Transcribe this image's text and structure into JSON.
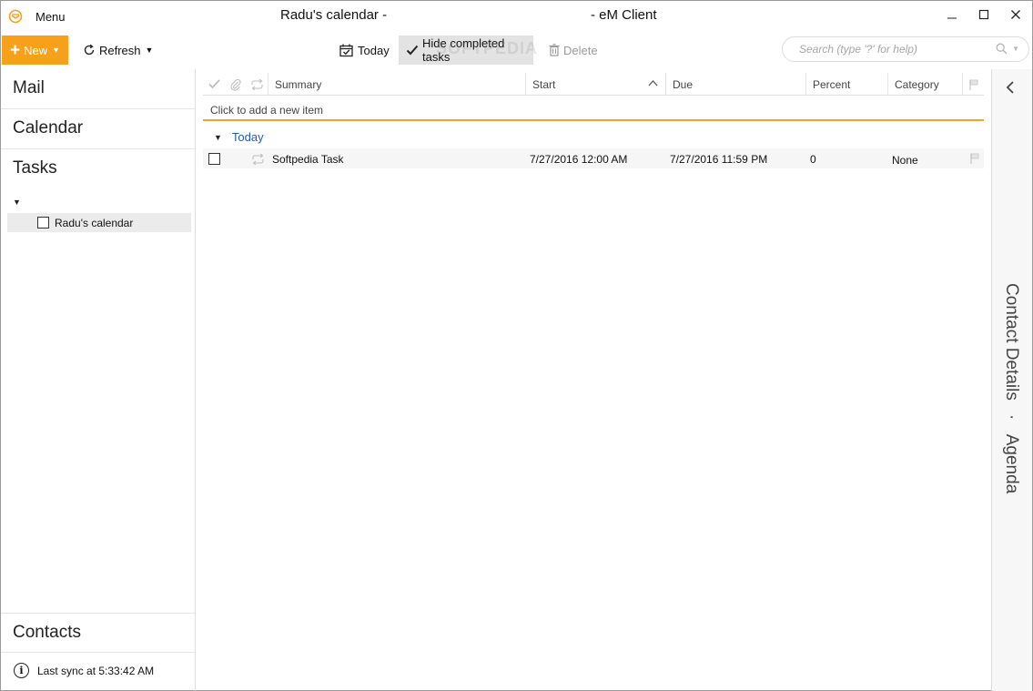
{
  "app": {
    "menu_label": "Menu",
    "title_left": "Radu's calendar -",
    "title_right": "- eM Client",
    "watermark": "SOFTPEDIA",
    "accent_color": "#f7a01b"
  },
  "window_controls": {
    "minimize_icon": "minimize-icon",
    "maximize_icon": "maximize-icon",
    "close_icon": "close-icon"
  },
  "toolbar": {
    "new_label": "New",
    "refresh_label": "Refresh",
    "today_label": "Today",
    "hide_completed_label": "Hide completed tasks",
    "delete_label": "Delete"
  },
  "search": {
    "placeholder": "Search (type '?' for help)"
  },
  "sidebar": {
    "nav": [
      "Mail",
      "Calendar",
      "Tasks"
    ],
    "folders": [
      {
        "label": "Radu's calendar",
        "checked": false
      }
    ],
    "contacts_label": "Contacts",
    "sync_status": "Last sync at 5:33:42 AM"
  },
  "grid": {
    "columns": [
      "Summary",
      "Start",
      "Due",
      "Percent",
      "Category"
    ],
    "sorted_column": "Start",
    "add_row_label": "Click to add a new item",
    "group_label": "Today",
    "rows": [
      {
        "summary": "Softpedia Task",
        "start": "7/27/2016 12:00 AM",
        "due": "7/27/2016 11:59 PM",
        "percent": "0",
        "category": "None"
      }
    ]
  },
  "right_panel": {
    "contact_details_label": "Contact Details",
    "separator": "·",
    "agenda_label": "Agenda"
  }
}
